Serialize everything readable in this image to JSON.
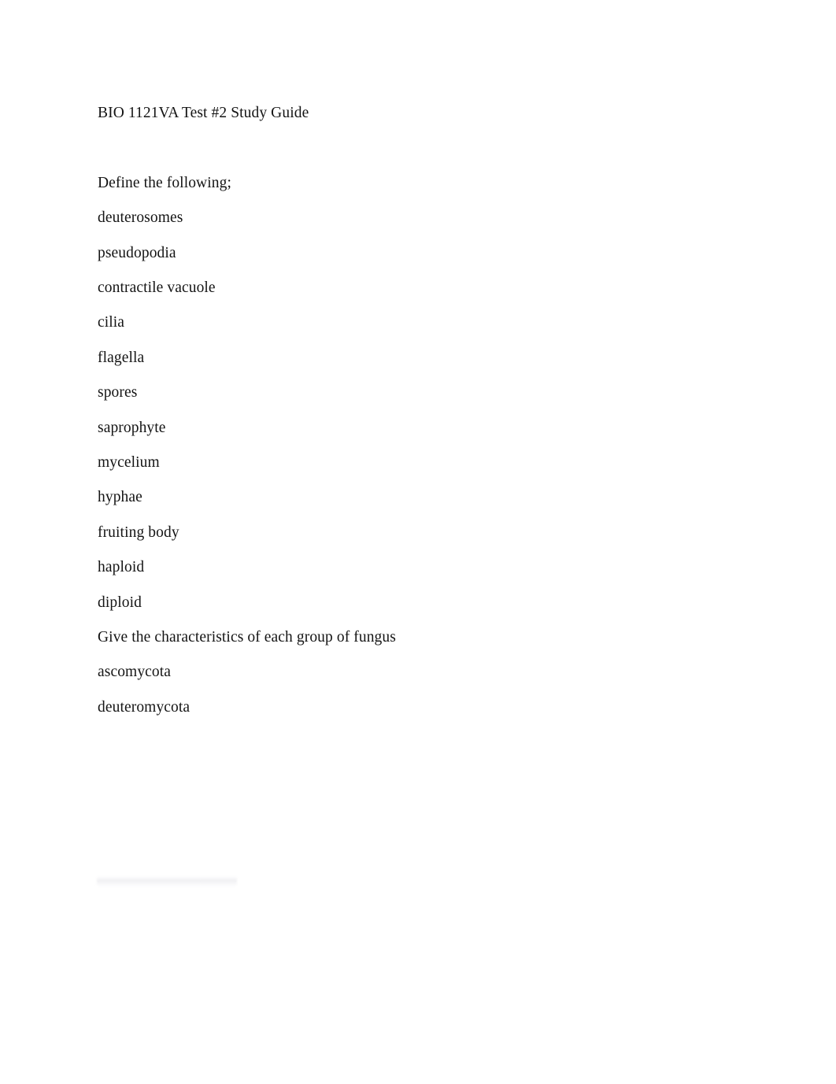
{
  "document": {
    "title": "BIO 1121VA Test #2 Study Guide",
    "text_color": "#141414",
    "background_color": "#ffffff",
    "blocks": [
      {
        "id": "title",
        "text": "BIO 1121VA Test #2 Study Guide"
      },
      {
        "id": "blank-1",
        "text": ""
      },
      {
        "id": "prompt-define",
        "text": "Define the following;"
      },
      {
        "id": "term-1",
        "text": "deuterosomes"
      },
      {
        "id": "term-2",
        "text": "pseudopodia"
      },
      {
        "id": "term-3",
        "text": "contractile vacuole"
      },
      {
        "id": "term-4",
        "text": "cilia"
      },
      {
        "id": "term-5",
        "text": "flagella"
      },
      {
        "id": "term-6",
        "text": "spores"
      },
      {
        "id": "term-7",
        "text": "saprophyte"
      },
      {
        "id": "term-8",
        "text": "mycelium"
      },
      {
        "id": "term-9",
        "text": "hyphae"
      },
      {
        "id": "term-10",
        "text": "fruiting body"
      },
      {
        "id": "term-11",
        "text": "haploid"
      },
      {
        "id": "term-12",
        "text": "diploid"
      },
      {
        "id": "prompt-fungus",
        "text": "Give the characteristics of each group of fungus"
      },
      {
        "id": "group-1",
        "text": "ascomycota"
      },
      {
        "id": "group-2",
        "text": "deuteromycota"
      }
    ]
  }
}
